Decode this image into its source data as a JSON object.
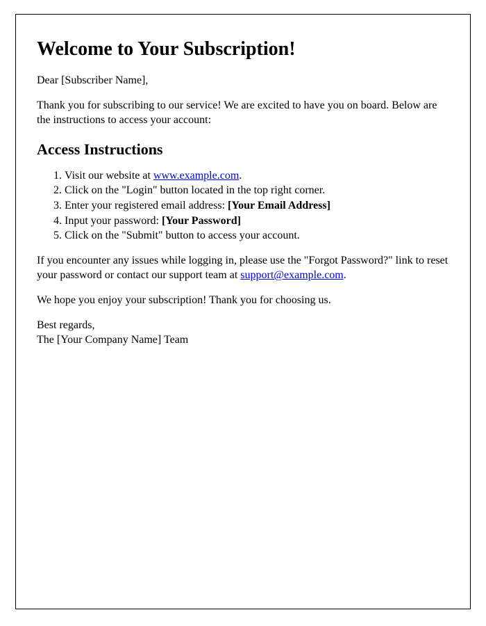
{
  "heading": "Welcome to Your Subscription!",
  "greeting": "Dear [Subscriber Name],",
  "intro": "Thank you for subscribing to our service! We are excited to have you on board. Below are the instructions to access your account:",
  "instructions_heading": "Access Instructions",
  "steps": {
    "step1_pre": "Visit our website at ",
    "step1_link": "www.example.com",
    "step1_post": ".",
    "step2": "Click on the \"Login\" button located in the top right corner.",
    "step3_pre": "Enter your registered email address: ",
    "step3_bold": "[Your Email Address]",
    "step4_pre": "Input your password: ",
    "step4_bold": "[Your Password]",
    "step5": "Click on the \"Submit\" button to access your account."
  },
  "support_pre": "If you encounter any issues while logging in, please use the \"Forgot Password?\" link to reset your password or contact our support team at ",
  "support_link": "support@example.com",
  "support_post": ".",
  "closing": "We hope you enjoy your subscription! Thank you for choosing us.",
  "signoff_line1": "Best regards,",
  "signoff_line2": "The [Your Company Name] Team",
  "website_href": "#",
  "support_href": "#"
}
